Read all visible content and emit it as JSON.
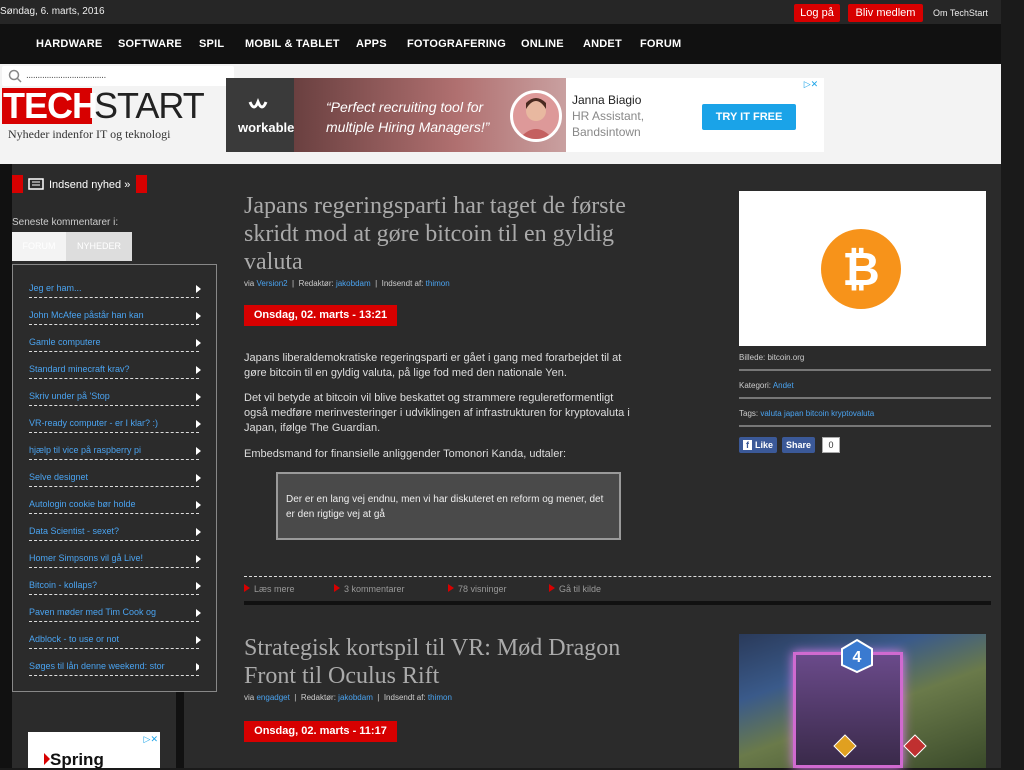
{
  "topbar": {
    "date": "Søndag, 6. marts, 2016",
    "login": "Log på",
    "register": "Bliv medlem",
    "about": "Om TechStart"
  },
  "nav": [
    "HARDWARE",
    "SOFTWARE",
    "SPIL",
    "MOBIL & TABLET",
    "APPS",
    "FOTOGRAFERING",
    "ONLINE",
    "ANDET",
    "FORUM"
  ],
  "search": {
    "placeholder": "..................................."
  },
  "logo": {
    "part1": "TECH",
    "part2": "START",
    "tagline": "Nyheder indenfor IT og teknologi"
  },
  "ad": {
    "brand": "workable",
    "quote": "“Perfect recruiting tool for multiple Hiring Managers!”",
    "name": "Janna Biagio",
    "role_line1": "HR Assistant,",
    "role_line2": "Bandsintown",
    "cta": "TRY IT FREE",
    "close": "▷✕"
  },
  "sidebar": {
    "submit": "Indsend nyhed »",
    "latest": "Seneste kommentarer i:",
    "tab_forum": "FORUM",
    "tab_news": "NYHEDER",
    "comments": [
      "Jeg er ham...",
      "John McAfee påstår han kan",
      "Gamle computere",
      "Standard minecraft krav?",
      "Skriv under på 'Stop",
      "VR-ready computer - er I klar? :)",
      "hjælp til vice på raspberry pi",
      "Selve designet",
      "Autologin cookie bør holde",
      "Data Scientist - sexet?",
      "Homer Simpsons vil gå Live!",
      "Bitcoin - kollaps?",
      "Paven møder med Tim Cook og",
      "Adblock - to use or not",
      "Søges til lån denne weekend: stor"
    ],
    "spring_ad": "Spring",
    "spring_close": "▷✕"
  },
  "article1": {
    "title": "Japans regeringsparti har taget de første skridt mod at gøre bitcoin til en gyldig valuta",
    "via_label": "via",
    "via": "Version2",
    "editor_label": "Redaktør:",
    "editor": "jakobdam",
    "submitted_label": "Indsendt af:",
    "submitted_by": "thimon",
    "date": "Onsdag, 02. marts - 13:21",
    "p1": "Japans liberaldemokratiske regeringsparti er gået i gang med forarbejdet til at gøre bitcoin til en gyldig valuta, på lige fod med den nationale Yen.",
    "p2": "Det vil betyde at bitcoin vil blive beskattet og strammere reguleretformentligt også medføre merinvesteringer i udviklingen af infrastrukturen for kryptovaluta i Japan, ifølge The Guardian.",
    "p3": "Embedsmand for finansielle anliggender Tomonori Kanda, udtaler:",
    "quote": "Der er en lang vej endnu, men vi har diskuteret en reform og mener, det er den rigtige vej at gå",
    "actions": [
      "Læs mere",
      "3 kommentarer",
      "78 visninger",
      "Gå til kilde"
    ],
    "caption": "Billede: bitcoin.org",
    "category_label": "Kategori:",
    "category": "Andet",
    "tags_label": "Tags:",
    "tags": [
      "valuta",
      "japan",
      "bitcoin",
      "kryptovaluta"
    ],
    "like": "Like",
    "share": "Share",
    "share_count": "0"
  },
  "article2": {
    "title": "Strategisk kortspil til VR: Mød Dragon Front til Oculus Rift",
    "via_label": "via",
    "via": "engadget",
    "editor_label": "Redaktør:",
    "editor": "jakobdam",
    "submitted_label": "Indsendt af:",
    "submitted_by": "thimon",
    "date": "Onsdag, 02. marts - 11:17"
  },
  "colors": {
    "accent": "#d70000",
    "link": "#4aa3f0",
    "background": "#2b2b2b"
  }
}
